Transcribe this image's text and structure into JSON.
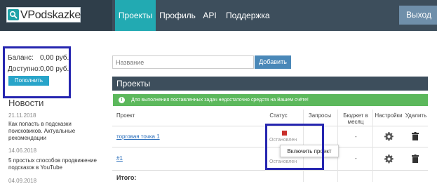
{
  "header": {
    "logo_text": "VPodskazke",
    "nav": [
      "Проекты",
      "Профиль",
      "API",
      "Поддержка"
    ],
    "logout_label": "Выход"
  },
  "sidebar": {
    "balance_label": "Баланс:",
    "balance_value": "0,00 руб.",
    "available_label": "Доступно:",
    "available_value": "0,00 руб.",
    "topup_label": "Пополнить",
    "news_title": "Новости",
    "news": [
      {
        "date": "21.11.2018",
        "text": "Как попасть в подсказки поисковиков. Актуальные рекомендации"
      },
      {
        "date": "14.06.2018",
        "text": "5 простых способов продвижение подсказок в YouTube"
      },
      {
        "date": "04.09.2018",
        "text": ""
      }
    ]
  },
  "main": {
    "name_placeholder": "Название",
    "add_label": "Добавить",
    "panel_title": "Проекты",
    "alert_text": "Для выполнения поставленных задач недостаточно средств на Вашем счёте!",
    "columns": [
      "Проект",
      "Статус",
      "Запросы",
      "Бюджет в месяц",
      "Настройки",
      "Удалить"
    ],
    "rows": [
      {
        "name": "торговая точка 1",
        "status": "Остановлен",
        "budget": "-"
      },
      {
        "name": "#1",
        "status": "Остановлен",
        "budget": "-"
      }
    ],
    "tooltip": "Включить проект",
    "total_label": "Итого:"
  },
  "icons": {
    "logo": "search-icon",
    "status": "stop-square-icon",
    "settings": "gear-icon",
    "delete": "trash-icon",
    "alert": "info-icon"
  },
  "colors": {
    "topbar": "#3d4e5c",
    "active_nav": "#22aab2",
    "alert": "#5cb85c",
    "link": "#2a6ebb",
    "status_stopped": "#c9302c",
    "highlight_box": "#2626b0"
  }
}
